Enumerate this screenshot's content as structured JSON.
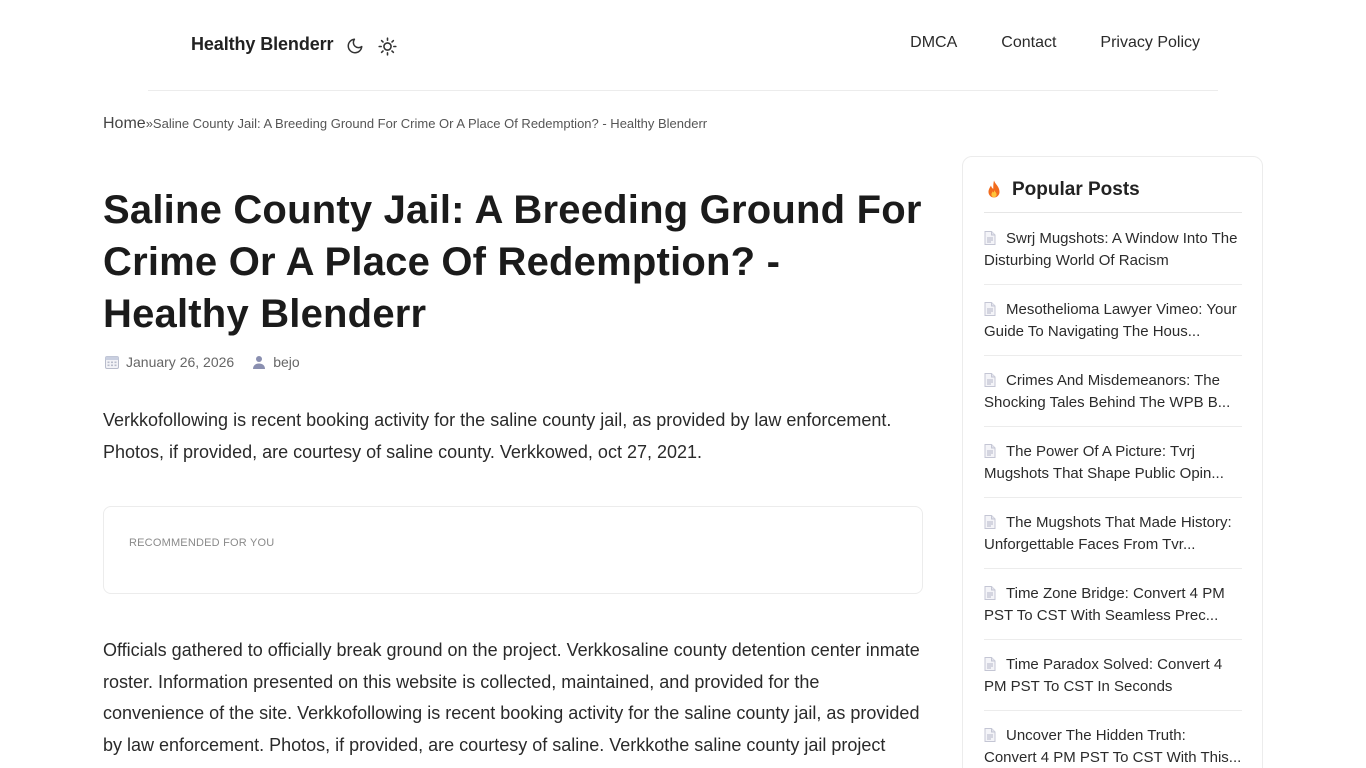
{
  "header": {
    "brand": "Healthy Blenderr",
    "nav": [
      "DMCA",
      "Contact",
      "Privacy Policy"
    ]
  },
  "breadcrumb": {
    "home": "Home",
    "separator": "»",
    "current": "Saline County Jail: A Breeding Ground For Crime Or A Place Of Redemption? - Healthy Blenderr"
  },
  "article": {
    "title": "Saline County Jail: A Breeding Ground For Crime Or A Place Of Redemption? - Healthy Blenderr",
    "date": "January 26, 2026",
    "author": "bejo",
    "paragraph1": "Verkkofollowing is recent booking activity for the saline county jail, as provided by law enforcement. Photos, if provided, are courtesy of saline county. Verkkowed, oct 27, 2021.",
    "recommended_label": "RECOMMENDED FOR YOU",
    "paragraph2": "Officials gathered to officially break ground on the project. Verkkosaline county detention center inmate roster. Information presented on this website is collected, maintained, and provided for the convenience of the site. Verkkofollowing is recent booking activity for the saline county jail, as provided by law enforcement. Photos, if provided, are courtesy of saline. Verkkothe saline county jail project took a big"
  },
  "sidebar": {
    "title": "Popular Posts",
    "posts": [
      "Swrj Mugshots: A Window Into The Disturbing World Of Racism",
      "Mesothelioma Lawyer Vimeo: Your Guide To Navigating The Hous...",
      "Crimes And Misdemeanors: The Shocking Tales Behind The WPB B...",
      "The Power Of A Picture: Tvrj Mugshots That Shape Public Opin...",
      "The Mugshots That Made History: Unforgettable Faces From Tvr...",
      "Time Zone Bridge: Convert 4 PM PST To CST With Seamless Prec...",
      "Time Paradox Solved: Convert 4 PM PST To CST In Seconds",
      "Uncover The Hidden Truth: Convert 4 PM PST To CST With This..."
    ]
  },
  "colors": {
    "text": "#1b1b1b",
    "border": "#ececec",
    "fire": "#f26b1d",
    "doc_icon": "#b9b9c9"
  },
  "icons": {
    "theme_dark": "moon-icon",
    "theme_light": "sun-icon",
    "date": "calendar-icon",
    "author": "user-icon",
    "popular": "fire-icon",
    "post": "document-icon"
  }
}
